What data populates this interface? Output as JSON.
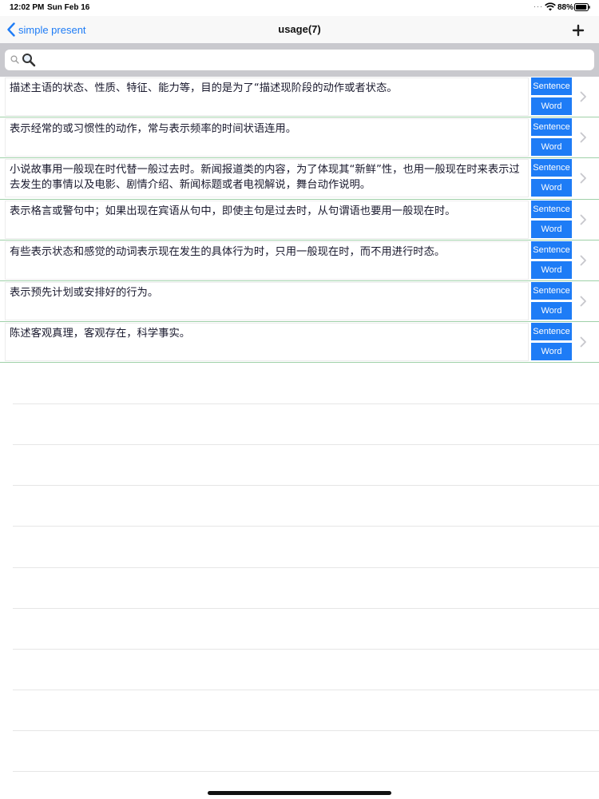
{
  "status_bar": {
    "time": "12:02 PM",
    "date": "Sun Feb 16",
    "battery": "88%",
    "icons": [
      "wifi-icon",
      "battery-icon"
    ]
  },
  "nav": {
    "back_label": "simple present",
    "title": "usage(7)",
    "add_icon": "plus-icon"
  },
  "search": {
    "placeholder": "",
    "value": ""
  },
  "list": {
    "sentence_label": "Sentence",
    "word_label": "Word",
    "items": [
      "描述主语的状态、性质、特征、能力等，目的是为了“描述现阶段的动作或者状态。",
      "表示经常的或习惯性的动作，常与表示频率的时间状语连用。",
      "小说故事用一般现在时代替一般过去时。新闻报道类的内容，为了体现其“新鲜”性，也用一般现在时来表示过去发生的事情以及电影、剧情介绍、新闻标题或者电视解说，舞台动作说明。",
      "表示格言或警句中；如果出现在宾语从句中，即使主句是过去时，从句谓语也要用一般现在时。",
      "有些表示状态和感觉的动词表示现在发生的具体行为时，只用一般现在时，而不用进行时态。",
      "表示预先计划或安排好的行为。",
      "陈述客观真理，客观存在，科学事实。"
    ]
  },
  "colors": {
    "accent": "#1e7cf6",
    "row_separator": "#9fd0a8",
    "search_bar_bg": "#c9c9ce"
  }
}
